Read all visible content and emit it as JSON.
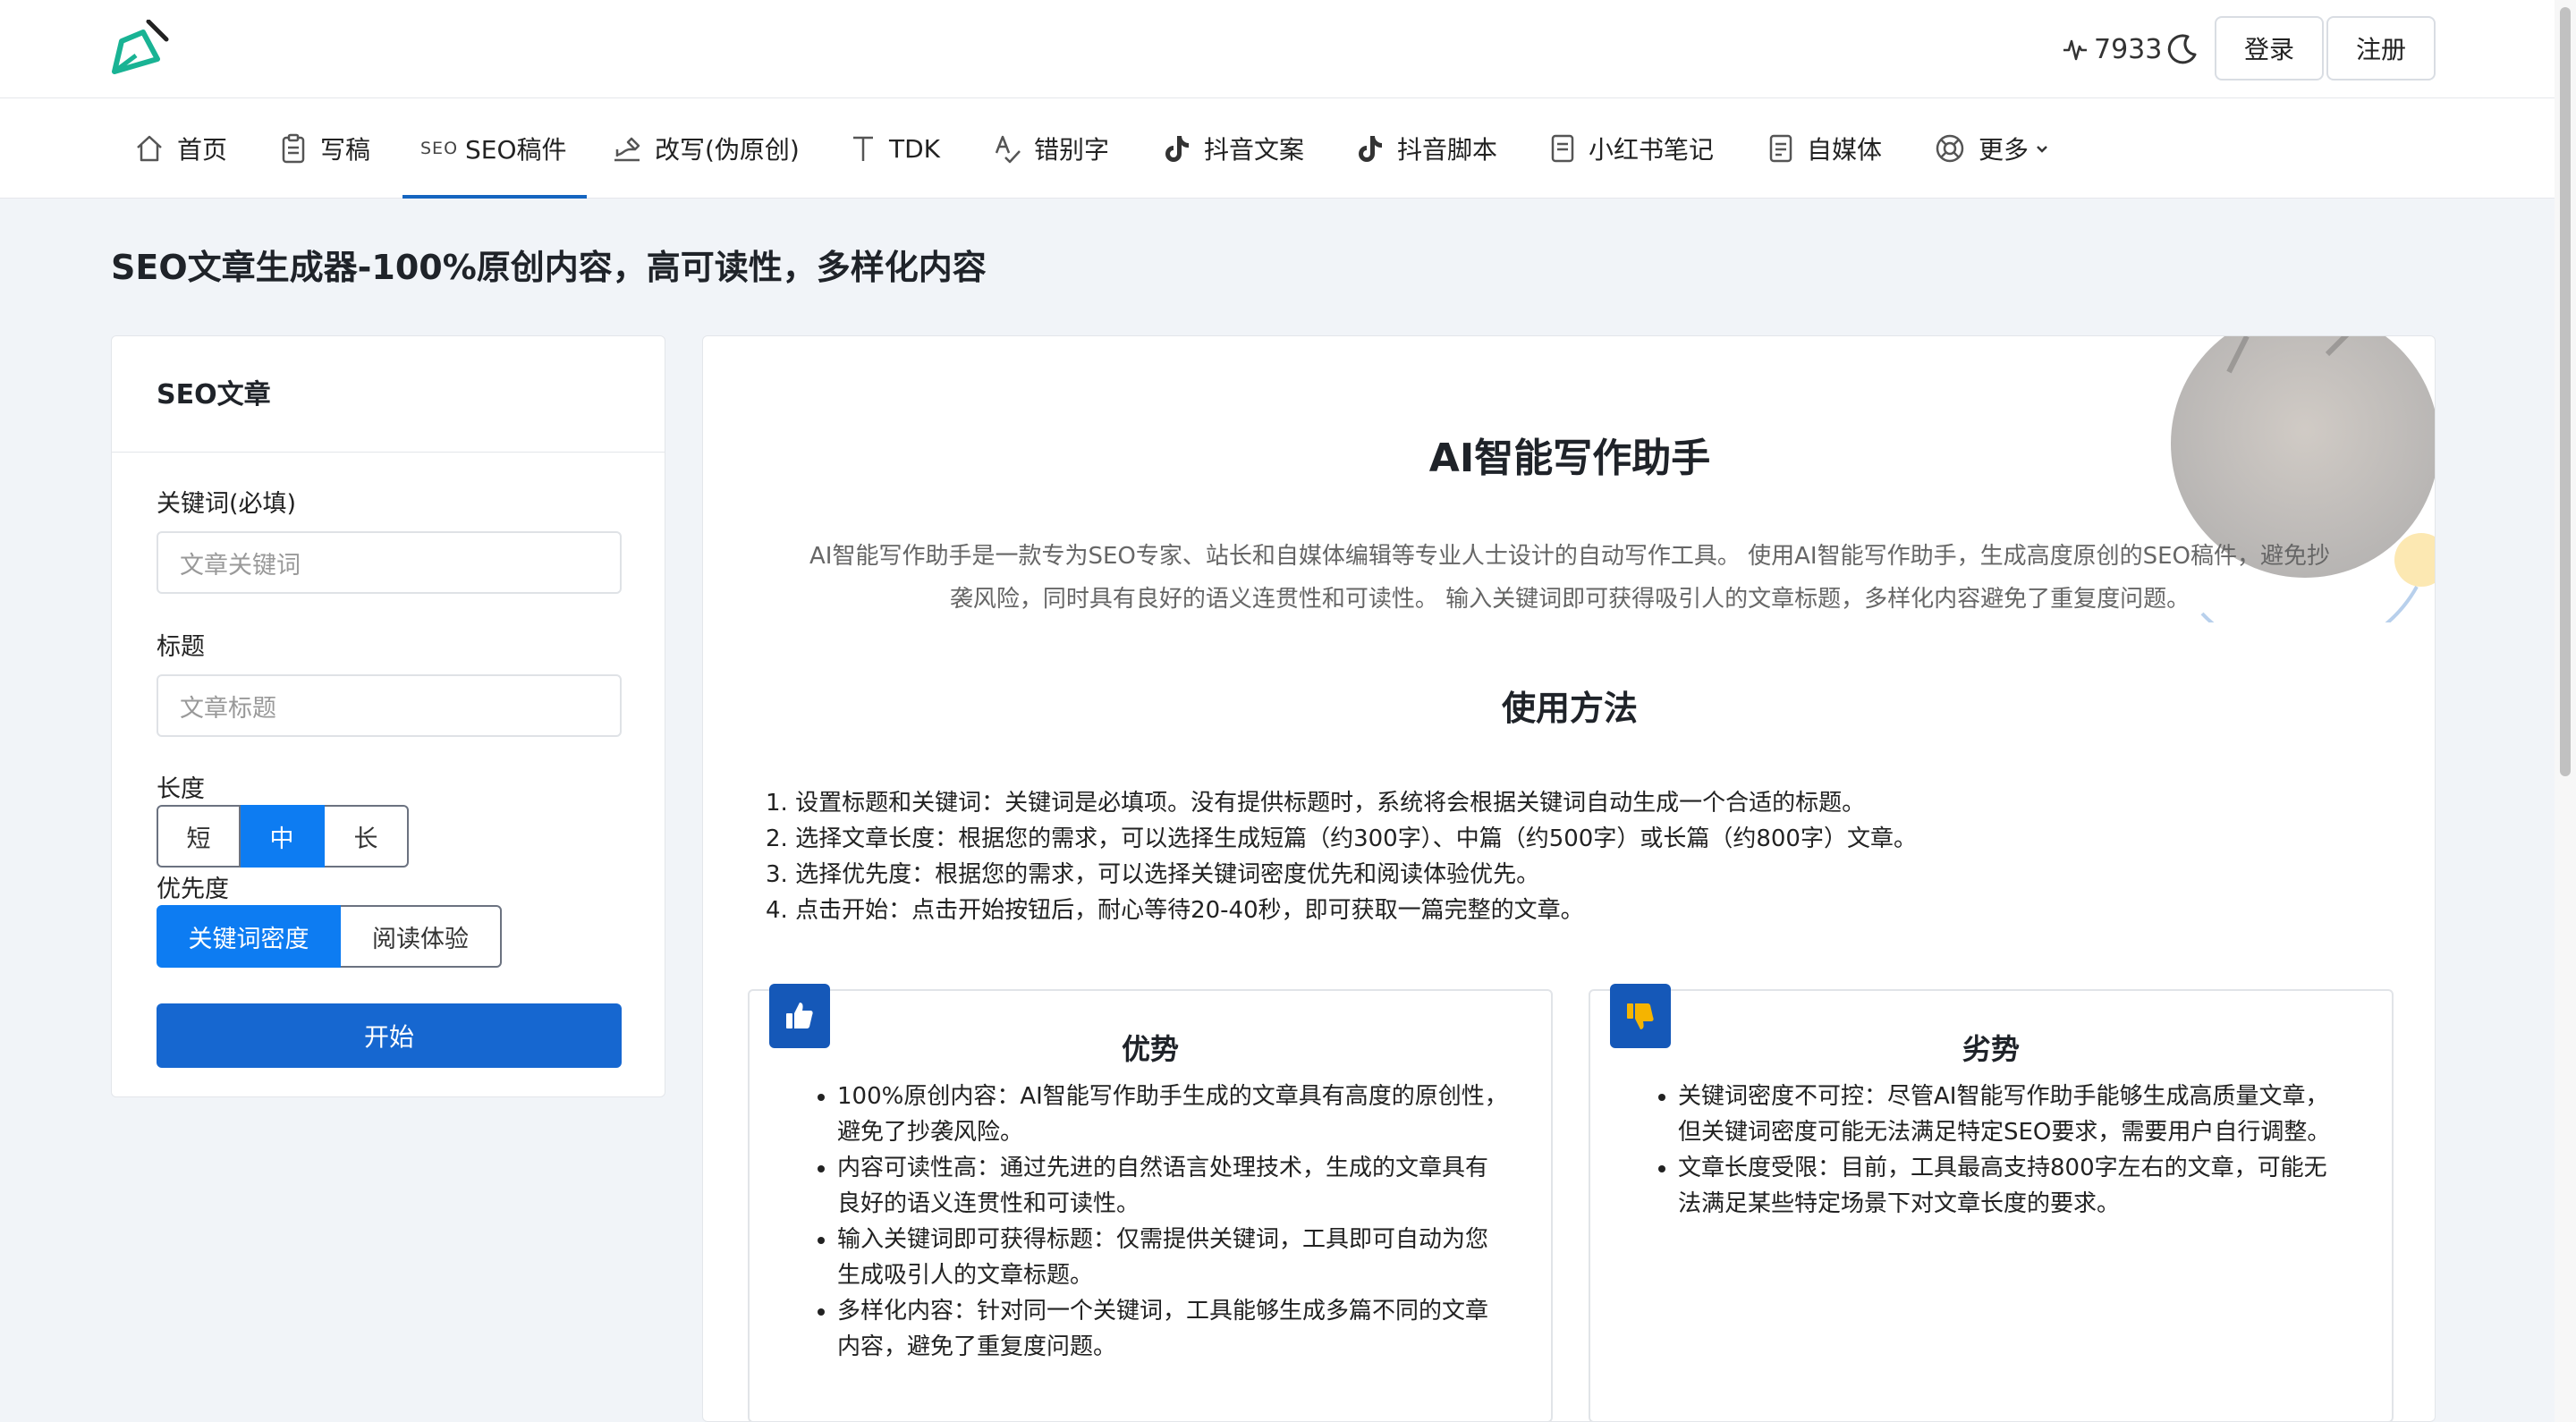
{
  "header": {
    "visitor_count": "7933",
    "login_label": "登录",
    "register_label": "注册"
  },
  "nav": {
    "items": [
      {
        "label": "首页",
        "icon": "home-icon"
      },
      {
        "label": "写稿",
        "icon": "clipboard-icon"
      },
      {
        "label": "SEO稿件",
        "icon": "seo-icon",
        "active": true
      },
      {
        "label": "改写(伪原创)",
        "icon": "rewrite-icon"
      },
      {
        "label": "TDK",
        "icon": "text-t-icon"
      },
      {
        "label": "错别字",
        "icon": "spell-check-icon"
      },
      {
        "label": "抖音文案",
        "icon": "tiktok-icon"
      },
      {
        "label": "抖音脚本",
        "icon": "tiktok-icon"
      },
      {
        "label": "小红书笔记",
        "icon": "note-icon"
      },
      {
        "label": "自媒体",
        "icon": "document-icon"
      },
      {
        "label": "更多",
        "icon": "lifebuoy-icon"
      }
    ],
    "seo_mini_text": "SEO"
  },
  "page": {
    "title": "SEO文章生成器-100%原创内容，高可读性，多样化内容"
  },
  "form": {
    "panel_title": "SEO文章",
    "keyword_label": "关键词(必填)",
    "keyword_placeholder": "文章关键词",
    "title_label": "标题",
    "title_placeholder": "文章标题",
    "length_label": "长度",
    "length_options": [
      "短",
      "中",
      "长"
    ],
    "length_selected": "中",
    "priority_label": "优先度",
    "priority_options": [
      "关键词密度",
      "阅读体验"
    ],
    "priority_selected": "关键词密度",
    "start_label": "开始"
  },
  "main": {
    "heading": "AI智能写作助手",
    "intro_line1": "AI智能写作助手是一款专为SEO专家、站长和自媒体编辑等专业人士设计的自动写作工具。 使用AI智能写作助手，生成高度原创的SEO稿件，避免抄",
    "intro_line2": "袭风险，同时具有良好的语义连贯性和可读性。 输入关键词即可获得吸引人的文章标题，多样化内容避免了重复度问题。",
    "usage_title": "使用方法",
    "steps": [
      "1. 设置标题和关键词：关键词是必填项。没有提供标题时，系统将会根据关键词自动生成一个合适的标题。",
      "2. 选择文章长度：根据您的需求，可以选择生成短篇（约300字）、中篇（约500字）或长篇（约800字）文章。",
      "3. 选择优先度：根据您的需求，可以选择关键词密度优先和阅读体验优先。",
      "4. 点击开始：点击开始按钮后，耐心等待20-40秒，即可获取一篇完整的文章。"
    ],
    "pros": {
      "title": "优势",
      "items": [
        "100%原创内容：AI智能写作助手生成的文章具有高度的原创性，避免了抄袭风险。",
        "内容可读性高：通过先进的自然语言处理技术，生成的文章具有良好的语义连贯性和可读性。",
        "输入关键词即可获得标题：仅需提供关键词，工具即可自动为您生成吸引人的文章标题。",
        "多样化内容：针对同一个关键词，工具能够生成多篇不同的文章内容，避免了重复度问题。"
      ]
    },
    "cons": {
      "title": "劣势",
      "items": [
        "关键词密度不可控：尽管AI智能写作助手能够生成高质量文章，但关键词密度可能无法满足特定SEO要求，需要用户自行调整。",
        "文章长度受限：目前，工具最高支持800字左右的文章，可能无法满足某些特定场景下对文章长度的要求。"
      ]
    }
  },
  "colors": {
    "accent": "#0d7cf2",
    "primary_button": "#1667d0",
    "badge": "#1558b8",
    "page_bg": "#f1f4f8"
  }
}
